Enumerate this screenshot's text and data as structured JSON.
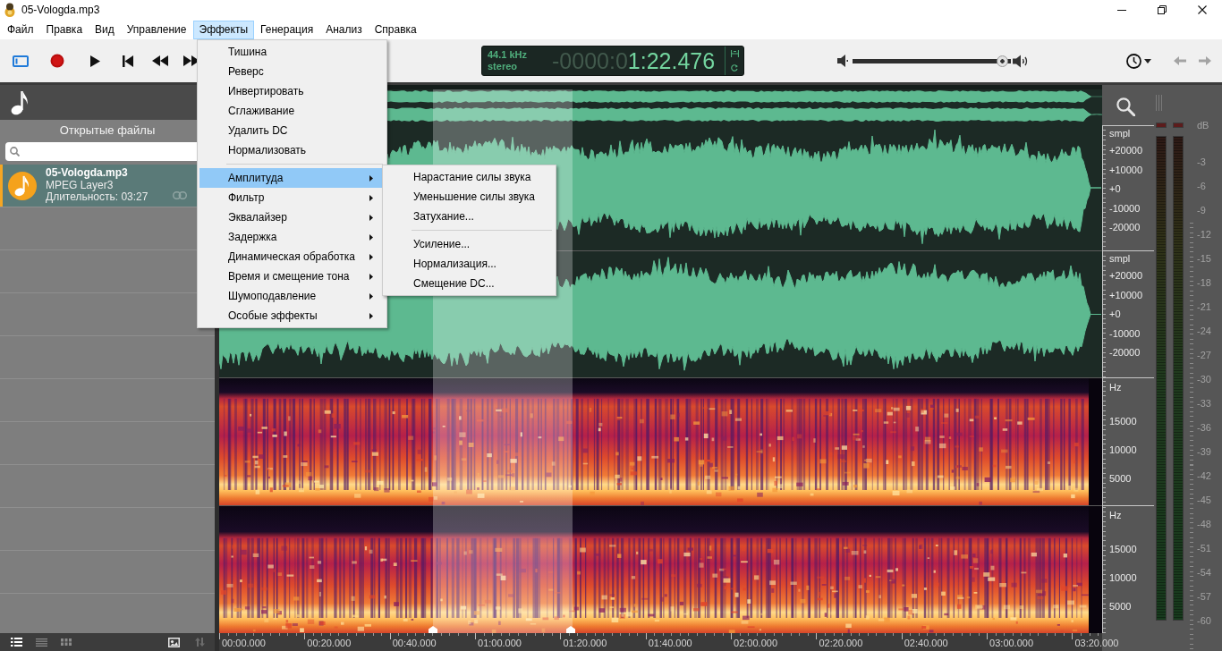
{
  "window": {
    "title": "05-Vologda.mp3"
  },
  "menu_bar": [
    {
      "label": "Файл",
      "selected": false
    },
    {
      "label": "Правка",
      "selected": false
    },
    {
      "label": "Вид",
      "selected": false
    },
    {
      "label": "Управление",
      "selected": false
    },
    {
      "label": "Эффекты",
      "selected": true
    },
    {
      "label": "Генерация",
      "selected": false
    },
    {
      "label": "Анализ",
      "selected": false
    },
    {
      "label": "Справка",
      "selected": false
    }
  ],
  "toolbar": {
    "panel_toggle": {
      "on": true
    },
    "history": [
      {
        "kind": "back",
        "disabled": true
      },
      {
        "kind": "forward",
        "disabled": true
      }
    ]
  },
  "display": {
    "sample_rate": "44.1 kHz",
    "channels": "stereo",
    "time_unlit": "-0000:0",
    "time": "1:22.476"
  },
  "volume": {
    "level": 0.98
  },
  "effects_menu": {
    "groups": [
      {
        "items": [
          {
            "label": "Тишина",
            "selected": false,
            "submenu": false
          },
          {
            "label": "Реверс",
            "selected": false,
            "submenu": false
          },
          {
            "label": "Инвертировать",
            "selected": false,
            "submenu": false
          },
          {
            "label": "Сглаживание",
            "selected": false,
            "submenu": false
          },
          {
            "label": "Удалить DC",
            "selected": false,
            "submenu": false
          },
          {
            "label": "Нормализовать",
            "selected": false,
            "submenu": false
          }
        ]
      },
      {
        "items": [
          {
            "label": "Амплитуда",
            "selected": true,
            "submenu": true
          },
          {
            "label": "Фильтр",
            "selected": false,
            "submenu": true
          },
          {
            "label": "Эквалайзер",
            "selected": false,
            "submenu": true
          },
          {
            "label": "Задержка",
            "selected": false,
            "submenu": true
          },
          {
            "label": "Динамическая обработка",
            "selected": false,
            "submenu": true
          },
          {
            "label": "Время и смещение тона",
            "selected": false,
            "submenu": true
          },
          {
            "label": "Шумоподавление",
            "selected": false,
            "submenu": true
          },
          {
            "label": "Особые эффекты",
            "selected": false,
            "submenu": true
          }
        ]
      }
    ]
  },
  "amplitude_submenu": {
    "groups": [
      {
        "items": [
          {
            "label": "Нарастание силы звука",
            "selected": false
          },
          {
            "label": "Уменьшение силы звука",
            "selected": false
          },
          {
            "label": "Затухание...",
            "selected": false
          }
        ]
      },
      {
        "items": [
          {
            "label": "Усиление...",
            "selected": false
          },
          {
            "label": "Нормализация...",
            "selected": false
          },
          {
            "label": "Смещение DC...",
            "selected": false
          }
        ]
      }
    ]
  },
  "sidebar": {
    "title": "Открытые файлы",
    "files": [
      {
        "name": "05-Vologda.mp3",
        "format": "MPEG Layer3",
        "duration": "Длительность: 03:27",
        "selected": true
      }
    ],
    "view_modes": [
      {
        "kind": "details",
        "selected": true
      },
      {
        "kind": "list",
        "selected": false
      },
      {
        "kind": "grid",
        "selected": false
      }
    ],
    "tools": [
      {
        "kind": "image",
        "disabled": false
      },
      {
        "kind": "sort",
        "disabled": true
      }
    ]
  },
  "tracks": [
    {
      "kind": "waveform",
      "axis": [
        "smpl",
        "+20000",
        "+10000",
        "+0",
        "-10000",
        "-20000"
      ]
    },
    {
      "kind": "waveform",
      "axis": [
        "smpl",
        "+20000",
        "+10000",
        "+0",
        "-10000",
        "-20000"
      ]
    },
    {
      "kind": "spectrogram",
      "axis": [
        "Hz",
        "15000",
        "10000",
        "5000"
      ]
    },
    {
      "kind": "spectrogram",
      "axis": [
        "Hz",
        "15000",
        "10000",
        "5000"
      ]
    }
  ],
  "timeline": [
    "00:00.000",
    "00:20.000",
    "00:40.000",
    "01:00.000",
    "01:20.000",
    "01:40.000",
    "02:00.000",
    "02:20.000",
    "02:40.000",
    "03:00.000",
    "03:20.000"
  ],
  "meter_scale": [
    "dB",
    "-3",
    "-6",
    "-9",
    "-12",
    "-15",
    "-18",
    "-21",
    "-24",
    "-27",
    "-30",
    "-33",
    "-36",
    "-39",
    "-42",
    "-45",
    "-48",
    "-51",
    "-54",
    "-57",
    "-60"
  ]
}
